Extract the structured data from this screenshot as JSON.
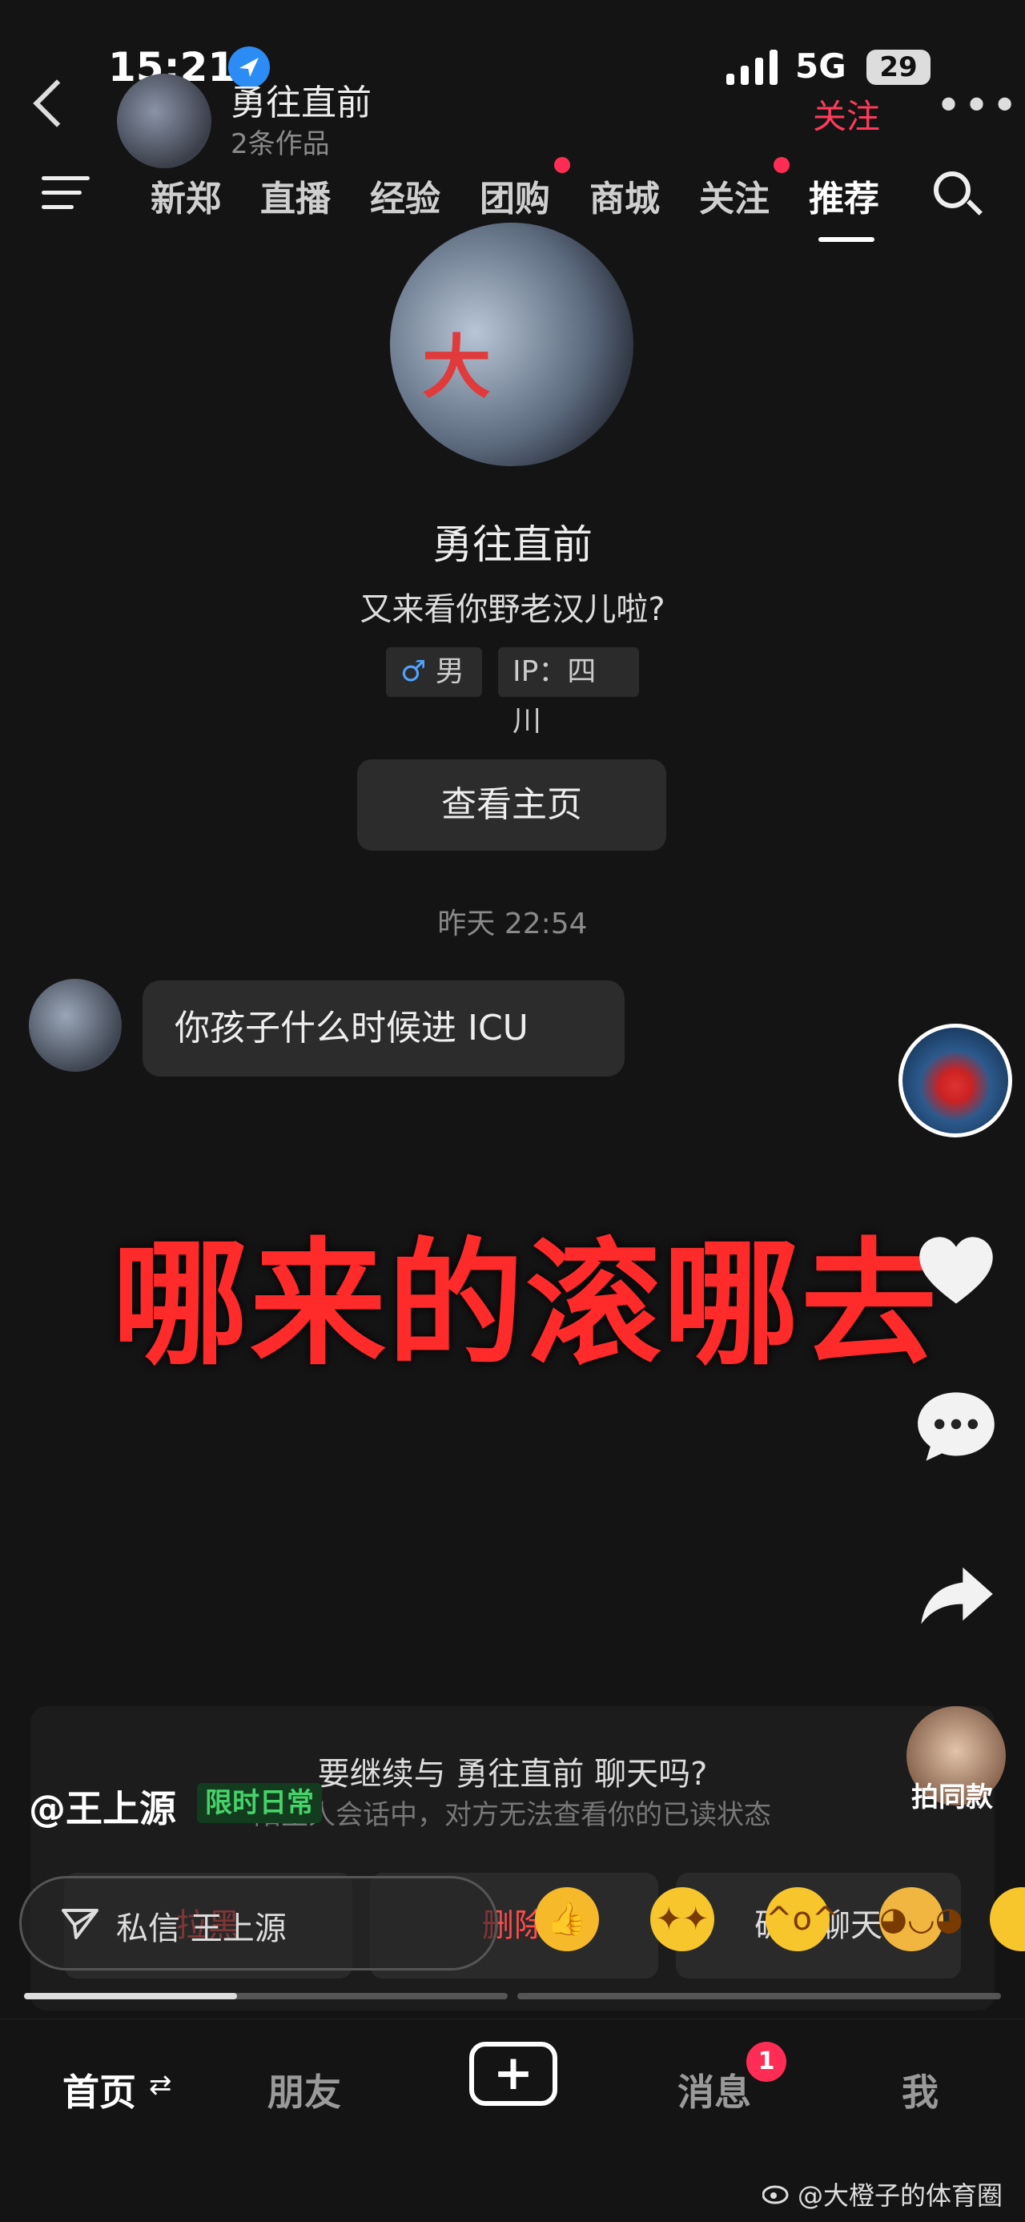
{
  "status": {
    "time": "15:21",
    "network": "5G",
    "battery": "29"
  },
  "header": {
    "name": "勇往直前",
    "works": "2条作品",
    "follow": "关注"
  },
  "nav": {
    "items": [
      "新郑",
      "直播",
      "经验",
      "团购",
      "商城",
      "关注",
      "推荐"
    ]
  },
  "profile": {
    "avatar_text": "大",
    "name": "勇往直前",
    "bio": "又来看你野老汉儿啦?",
    "gender_symbol": "♂",
    "gender": "男",
    "ip": "IP：四川",
    "view_home": "查看主页"
  },
  "chat": {
    "time": "昨天 22:54",
    "message": "你孩子什么时候进 ICU"
  },
  "overlay_caption": "哪来的滚哪去",
  "sheet": {
    "question": "要继续与 勇往直前 聊天吗?",
    "note": "陌生人会话中，对方无法查看你的已读状态",
    "block": "拉黑",
    "delete": "删除",
    "confirm": "确认聊天"
  },
  "video": {
    "author": "@王上源",
    "author_tag": "限时日常",
    "same_style": "拍同款",
    "dm_label": "私信 王上源"
  },
  "progress": {
    "current": 0.44
  },
  "tabbar": {
    "home": "首页",
    "home_arrows": "⇄",
    "friends": "朋友",
    "messages": "消息",
    "me": "我",
    "badge": "1"
  },
  "watermark": "@大橙子的体育圈"
}
